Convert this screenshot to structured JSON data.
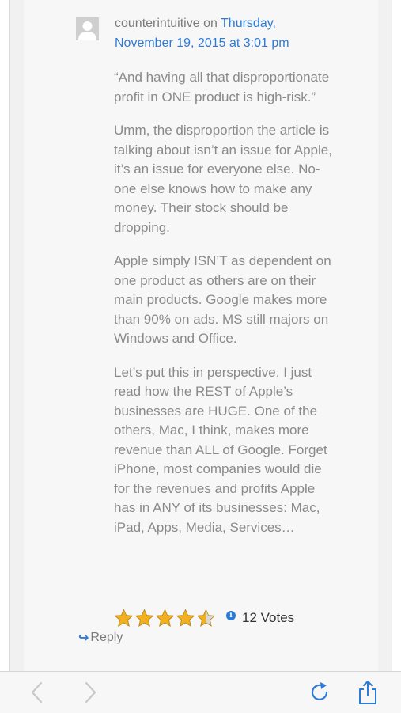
{
  "comment": {
    "author": "counterintuitive",
    "on_text": " on ",
    "date_link": "Thursday, November 19, 2015 at 3:01 pm",
    "paragraphs": [
      "“And having all that disproportionate profit in ONE product is high-risk.”",
      "Umm, the disproportion the article is talking about isn’t an issue for Apple, it’s an issue for everyone else. No-one else knows how to make any money. Their stock should be dropping.",
      "Apple simply ISN’T as dependent on one product as others are on their main products. Google makes more than 90% on ads. MS still majors on Windows and Office.",
      "Let’s put this in perspective. I just read how the REST of Apple’s businesses are HUGE. One of the others, Mac, I think, makes more revenue than ALL of Google. Forget iPhone, most companies would die for the revenues and profits Apple has in ANY of its businesses: Mac, iPad, Apps, Media, Services…"
    ],
    "rating": {
      "stars": 4.5,
      "votes_text": "12 Votes",
      "info_icon": "i"
    },
    "reply_label": "Reply",
    "reply_icon": "↪"
  },
  "toolbar": {
    "back_icon": "chevron-left-icon",
    "forward_icon": "chevron-right-icon",
    "reload_icon": "reload-icon",
    "share_icon": "share-icon"
  },
  "colors": {
    "link": "#2d7bd8",
    "star": "#f2b01e",
    "disabled_nav": "#c8c8c8"
  }
}
